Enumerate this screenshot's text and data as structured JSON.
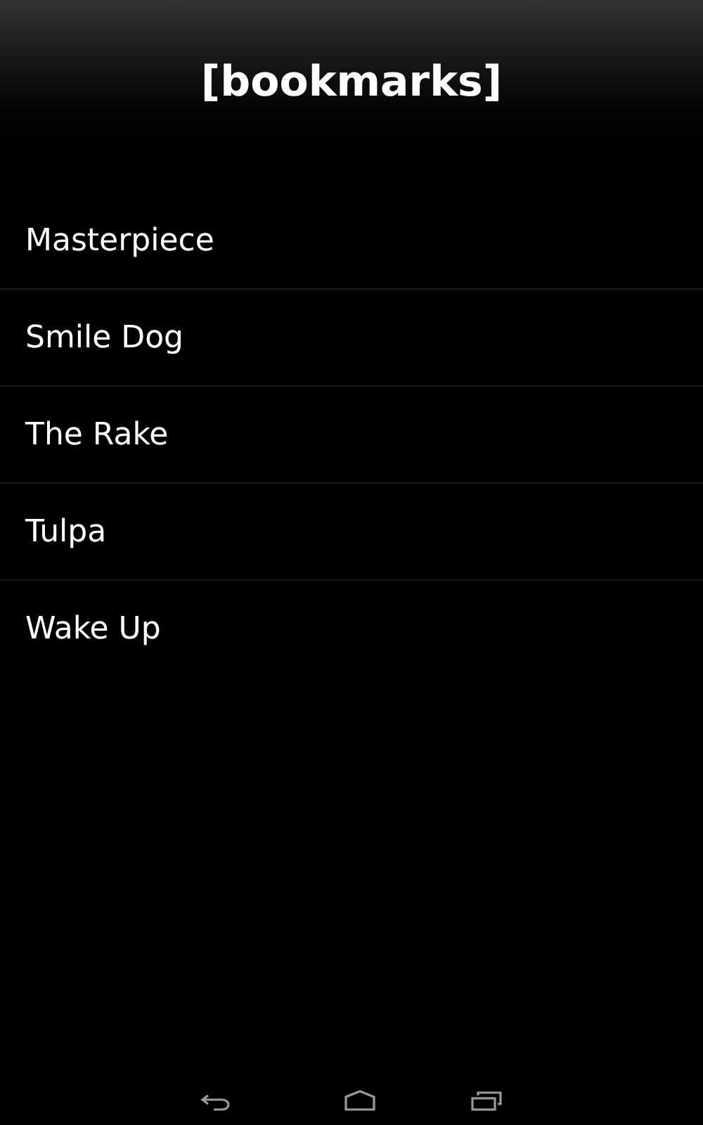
{
  "header": {
    "title": "[bookmarks]"
  },
  "bookmarks": [
    "Masterpiece",
    "Smile Dog",
    "The Rake",
    "Tulpa",
    "Wake Up"
  ]
}
